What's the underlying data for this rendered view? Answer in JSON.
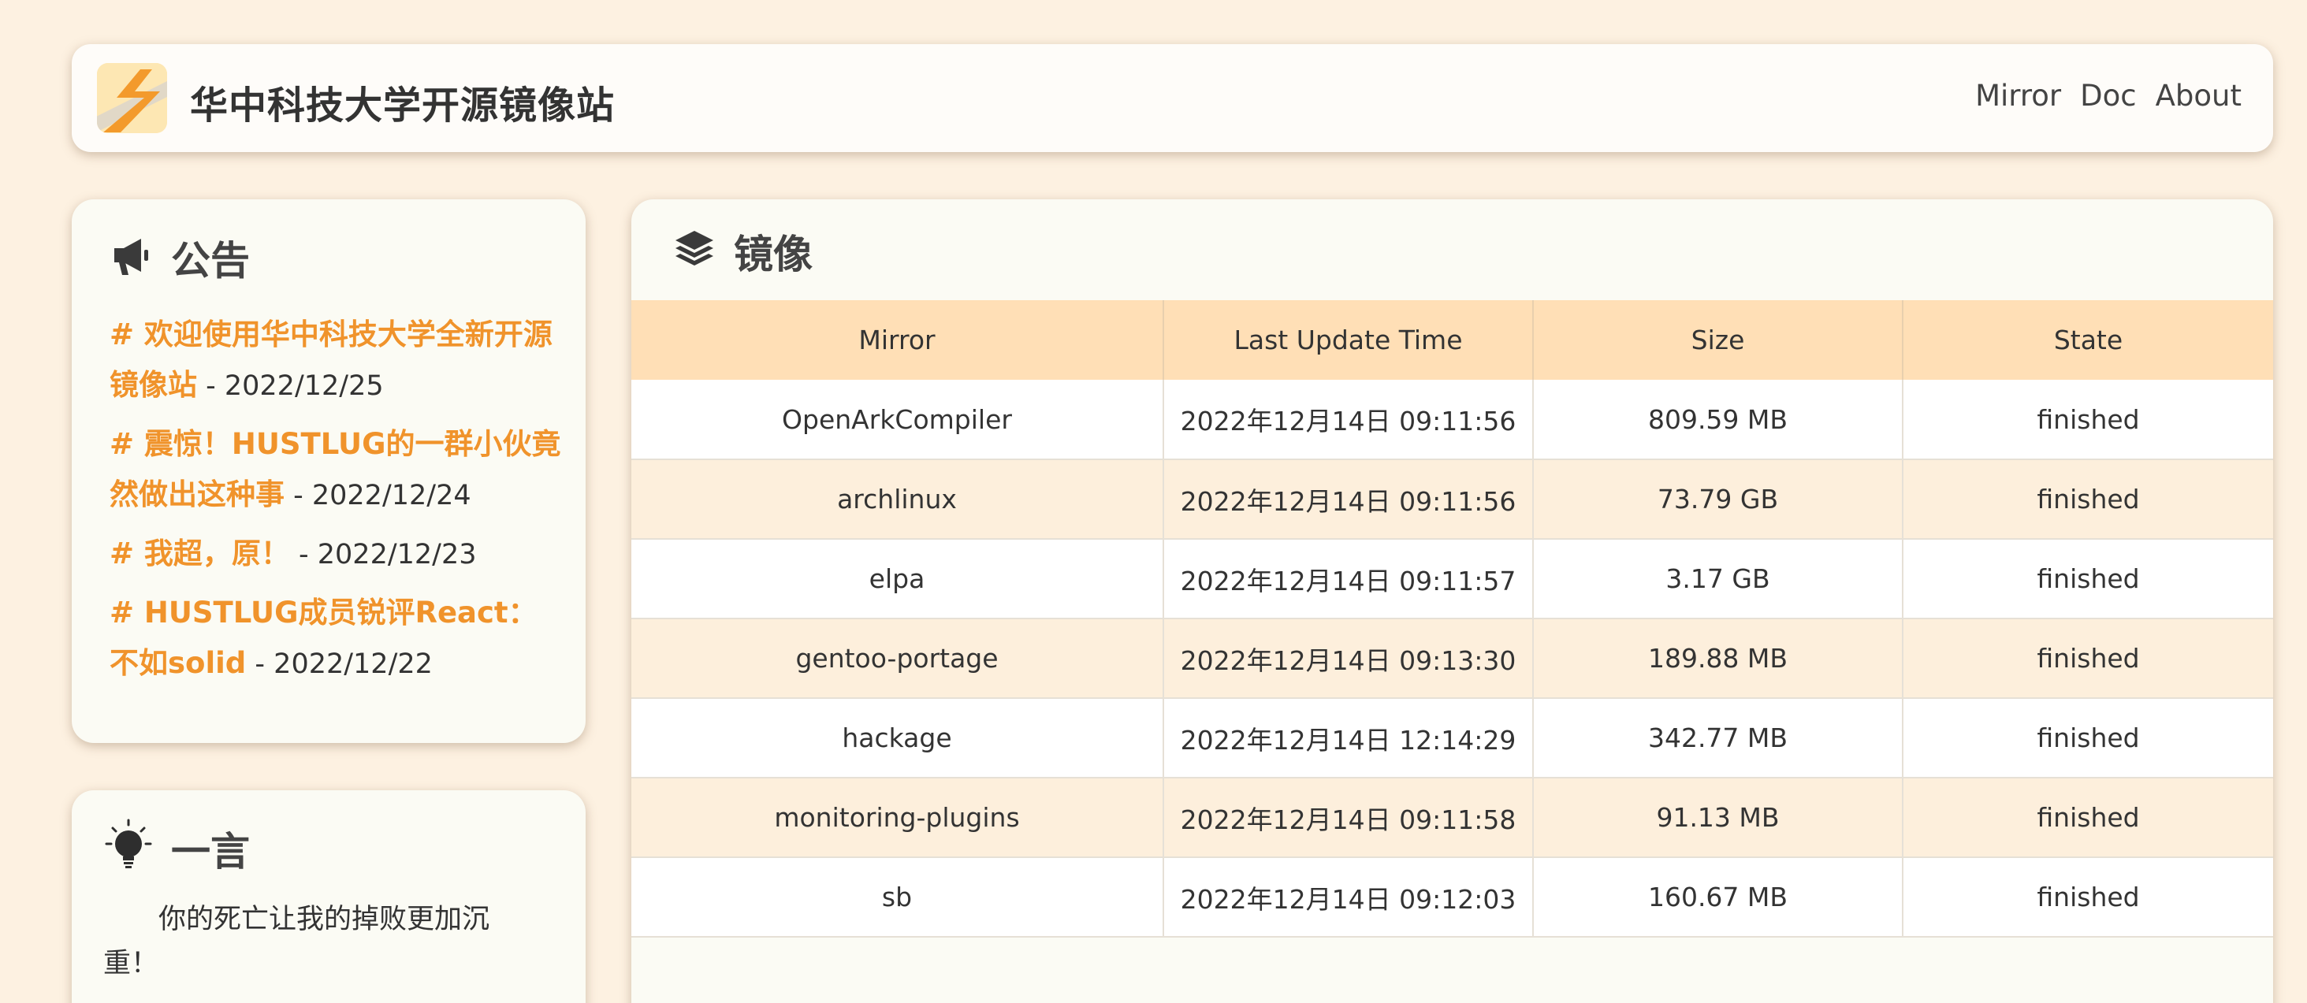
{
  "header": {
    "site_title": "华中科技大学开源镜像站",
    "nav": [
      "Mirror",
      "Doc",
      "About"
    ],
    "logo_icon": "hustlug-logo-icon"
  },
  "announcements": {
    "title": "公告",
    "icon": "megaphone-icon",
    "items": [
      {
        "text": "# 欢迎使用华中科技大学全新开源镜像站",
        "date": " - 2022/12/25"
      },
      {
        "text": "# 震惊！HUSTLUG的一群小伙竟然做出这种事",
        "date": " - 2022/12/24"
      },
      {
        "text": "# 我超，原！",
        "date": " - 2022/12/23"
      },
      {
        "text": "# HUSTLUG成员锐评React：不如solid",
        "date": " - 2022/12/22"
      }
    ]
  },
  "quote": {
    "title": "一言",
    "icon": "lightbulb-icon",
    "text": "你的死亡让我的掉败更加沉重！"
  },
  "mirrors": {
    "title": "镜像",
    "icon": "layers-icon",
    "columns": [
      "Mirror",
      "Last Update Time",
      "Size",
      "State"
    ],
    "rows": [
      [
        "OpenArkCompiler",
        "2022年12月14日 09:11:56",
        "809.59 MB",
        "finished"
      ],
      [
        "archlinux",
        "2022年12月14日 09:11:56",
        "73.79 GB",
        "finished"
      ],
      [
        "elpa",
        "2022年12月14日 09:11:57",
        "3.17 GB",
        "finished"
      ],
      [
        "gentoo-portage",
        "2022年12月14日 09:13:30",
        "189.88 MB",
        "finished"
      ],
      [
        "hackage",
        "2022年12月14日 12:14:29",
        "342.77 MB",
        "finished"
      ],
      [
        "monitoring-plugins",
        "2022年12月14日 09:11:58",
        "91.13 MB",
        "finished"
      ],
      [
        "sb",
        "2022年12月14日 09:12:03",
        "160.67 MB",
        "finished"
      ]
    ]
  },
  "colors": {
    "background": "#fdf1e1",
    "accent": "#f0932b",
    "table_header": "#ffdfb6",
    "row_alt": "#fdefdc"
  }
}
